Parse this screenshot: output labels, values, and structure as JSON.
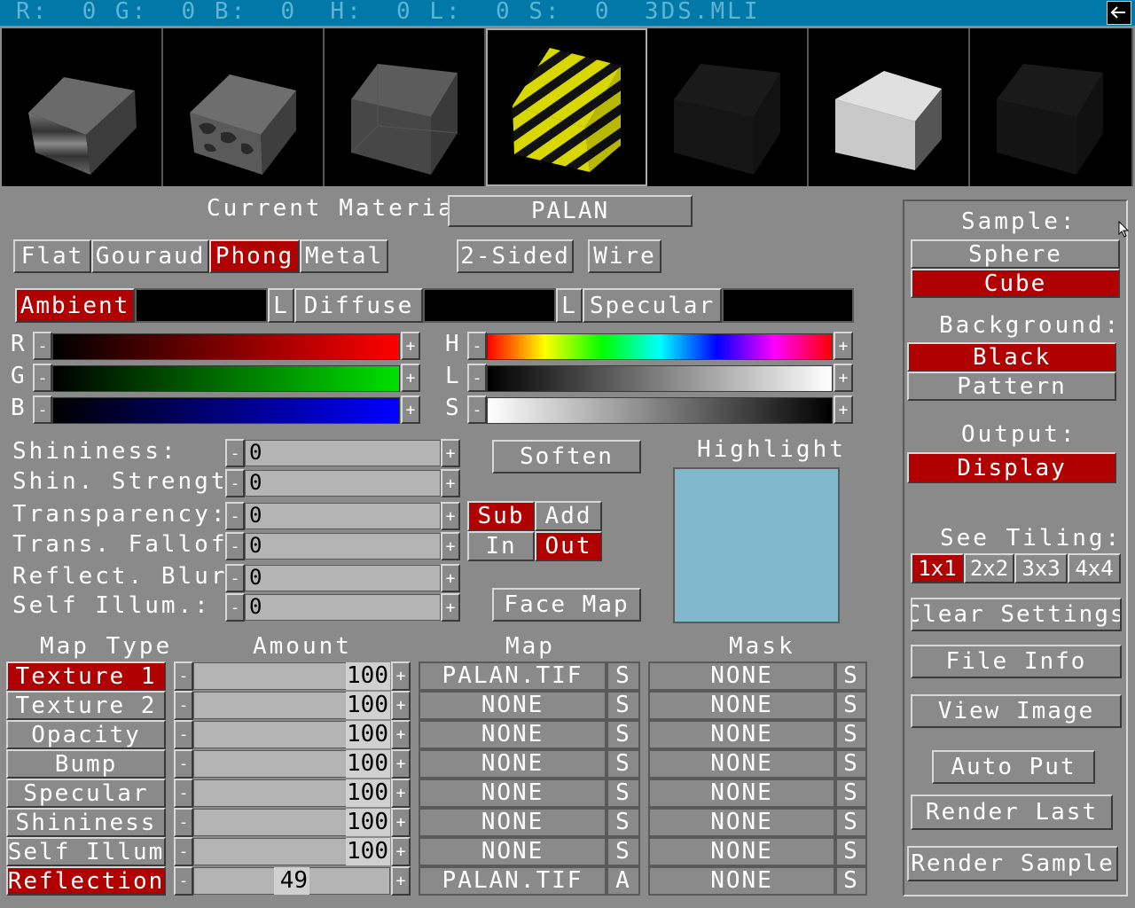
{
  "statusbar": {
    "text": "R:  0 G:  0 B:  0  H:  0 L:  0 S:  0  3DS.MLI",
    "back_icon": "arrow-left-icon",
    "color": "#0078a8"
  },
  "samples": [
    {
      "name": "wood-cube"
    },
    {
      "name": "camo-cube"
    },
    {
      "name": "glass-cube"
    },
    {
      "name": "hazard-cube"
    },
    {
      "name": "dark-cube"
    },
    {
      "name": "white-cube"
    },
    {
      "name": "black-cube"
    }
  ],
  "current_material": {
    "label": "Current Material:",
    "value": "PALAN"
  },
  "shading": {
    "flat": "Flat",
    "gouraud": "Gouraud",
    "phong": "Phong",
    "metal": "Metal",
    "two_sided": "2-Sided",
    "wire": "Wire"
  },
  "colors": {
    "ambient": "Ambient",
    "diffuse": "Diffuse",
    "specular": "Specular",
    "lock": "L"
  },
  "sliders": {
    "r": "R",
    "g": "G",
    "b": "B",
    "h": "H",
    "l": "L",
    "s": "S",
    "minus": "-",
    "plus": "+"
  },
  "props": [
    {
      "label": "Shininess:",
      "value": "0"
    },
    {
      "label": "Shin. Strength:",
      "value": "0"
    },
    {
      "label": "Transparency:",
      "value": "0"
    },
    {
      "label": "Trans. Falloff:",
      "value": "0"
    },
    {
      "label": "Reflect. Blur:",
      "value": "0"
    },
    {
      "label": "Self Illum.:",
      "value": "0"
    }
  ],
  "buttons": {
    "soften": "Soften",
    "sub": "Sub",
    "add": "Add",
    "in": "In",
    "out": "Out",
    "face_map": "Face Map",
    "highlight": "Highlight"
  },
  "map_headers": {
    "type": "Map Type",
    "amount": "Amount",
    "map": "Map",
    "mask": "Mask"
  },
  "maps": [
    {
      "type": "Texture 1",
      "amount": "100",
      "map": "PALAN.TIF",
      "s": "S",
      "mask": "NONE",
      "ms": "S"
    },
    {
      "type": "Texture 2",
      "amount": "100",
      "map": "NONE",
      "s": "S",
      "mask": "NONE",
      "ms": "S"
    },
    {
      "type": "Opacity",
      "amount": "100",
      "map": "NONE",
      "s": "S",
      "mask": "NONE",
      "ms": "S"
    },
    {
      "type": "Bump",
      "amount": "100",
      "map": "NONE",
      "s": "S",
      "mask": "NONE",
      "ms": "S"
    },
    {
      "type": "Specular",
      "amount": "100",
      "map": "NONE",
      "s": "S",
      "mask": "NONE",
      "ms": "S"
    },
    {
      "type": "Shininess",
      "amount": "100",
      "map": "NONE",
      "s": "S",
      "mask": "NONE",
      "ms": "S"
    },
    {
      "type": "Self Illum",
      "amount": "100",
      "map": "NONE",
      "s": "S",
      "mask": "NONE",
      "ms": "S"
    },
    {
      "type": "Reflection",
      "amount": "49",
      "map": "PALAN.TIF",
      "s": "A",
      "mask": "NONE",
      "ms": "S"
    }
  ],
  "right": {
    "sample": "Sample:",
    "sphere": "Sphere",
    "cube": "Cube",
    "background": "Background:",
    "black": "Black",
    "pattern": "Pattern",
    "output": "Output:",
    "display": "Display",
    "see_tiling": "See Tiling:",
    "t1": "1x1",
    "t2": "2x2",
    "t3": "3x3",
    "t4": "4x4",
    "clear": "Clear Settings",
    "file_info": "File Info",
    "view_image": "View Image",
    "auto_put": "Auto Put",
    "render_last": "Render Last",
    "render_sample": "Render Sample"
  }
}
